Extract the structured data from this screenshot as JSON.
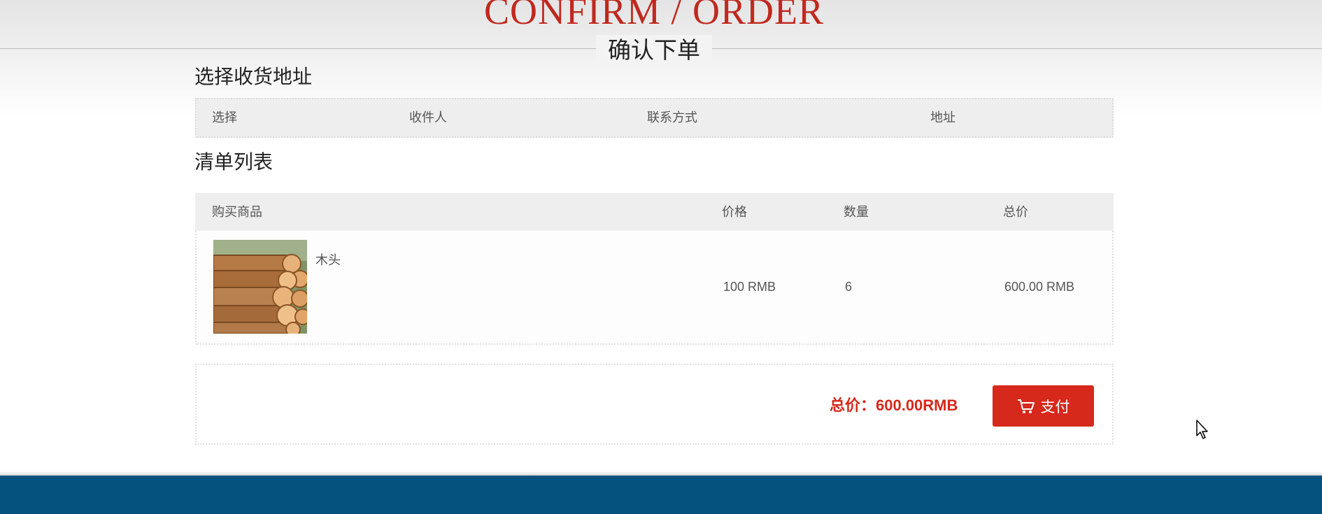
{
  "header": {
    "title": "CONFIRM / ORDER",
    "subtitle": "确认下单"
  },
  "address_section": {
    "title": "选择收货地址",
    "columns": [
      "选择",
      "收件人",
      "联系方式",
      "地址"
    ]
  },
  "list_section": {
    "title": "清单列表",
    "columns": [
      "购买商品",
      "价格",
      "数量",
      "总价"
    ],
    "items": [
      {
        "name": "木头",
        "price": "100 RMB",
        "quantity": "6",
        "total": "600.00 RMB",
        "image_icon": "logs-photo"
      }
    ]
  },
  "footer": {
    "total": "总价：600.00RMB",
    "pay_label": "支付",
    "pay_icon": "cart-icon"
  },
  "colors": {
    "accent": "#d6281b",
    "title_red": "#c0281e",
    "footer_blue": "#06527f"
  }
}
